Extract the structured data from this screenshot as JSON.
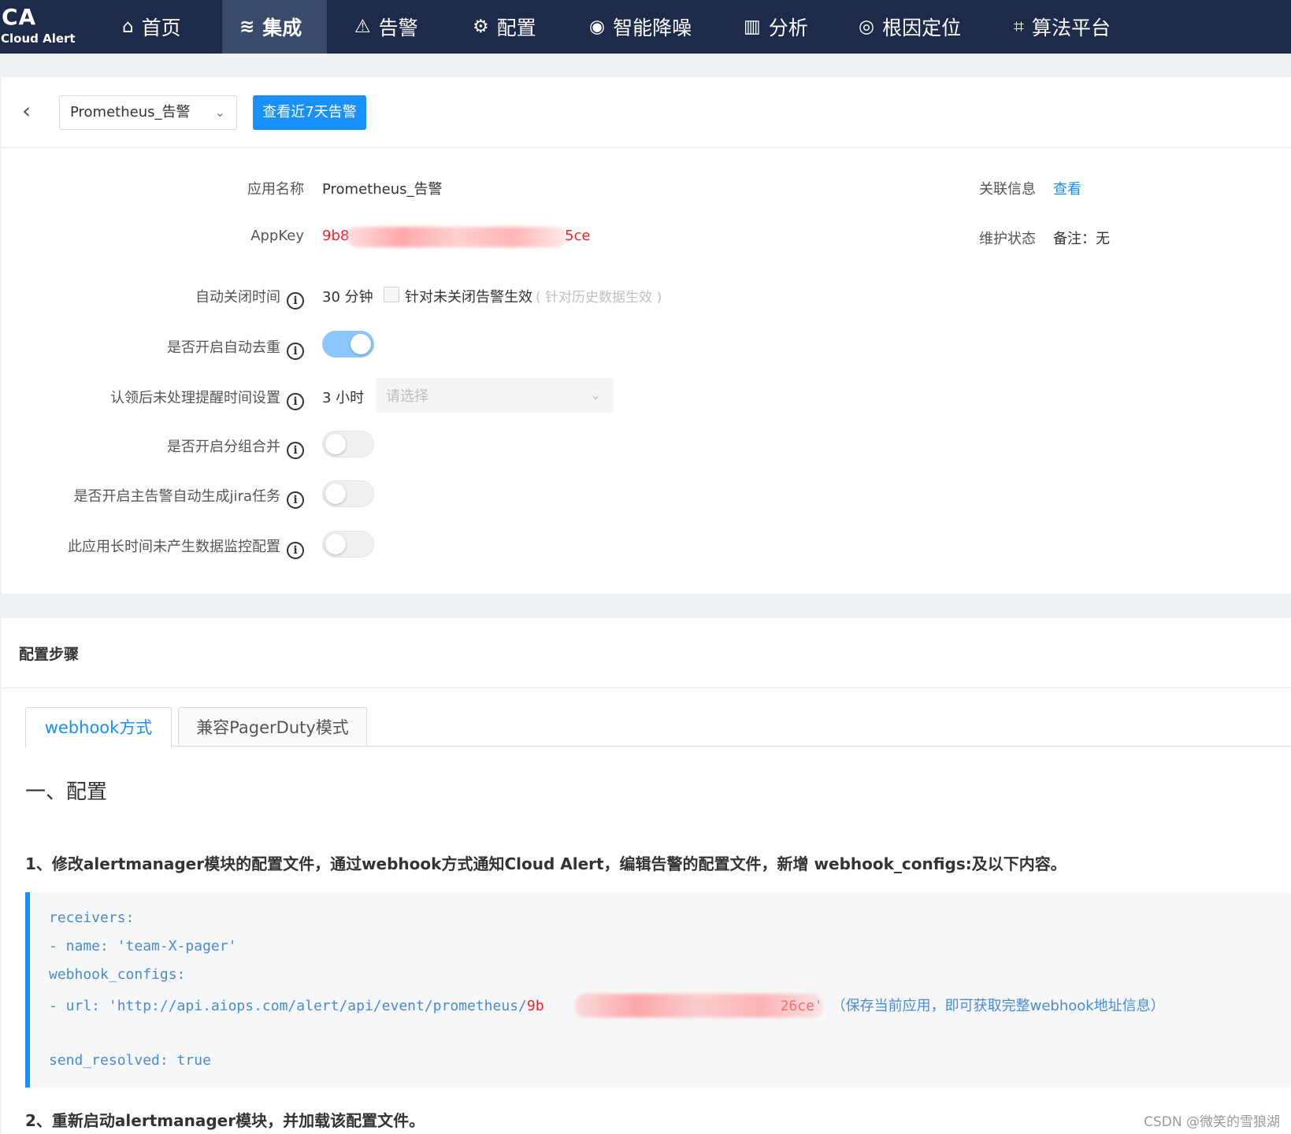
{
  "brand": {
    "logo": "CA",
    "name": "Cloud Alert"
  },
  "nav": [
    {
      "label": "首页",
      "icon": "home-icon",
      "glyph": "⌂"
    },
    {
      "label": "集成",
      "icon": "layers-icon",
      "glyph": "≋",
      "active": true
    },
    {
      "label": "告警",
      "icon": "alarm-icon",
      "glyph": "⚠"
    },
    {
      "label": "配置",
      "icon": "gear-icon",
      "glyph": "⚙"
    },
    {
      "label": "智能降噪",
      "icon": "noise-icon",
      "glyph": "◉"
    },
    {
      "label": "分析",
      "icon": "chart-icon",
      "glyph": "▥"
    },
    {
      "label": "根因定位",
      "icon": "target-icon",
      "glyph": "◎"
    },
    {
      "label": "算法平台",
      "icon": "algorithm-icon",
      "glyph": "⌗"
    }
  ],
  "header": {
    "back_glyph": "‹",
    "app_select_value": "Prometheus_告警",
    "caret_glyph": "⌄",
    "view_alerts_button": "查看近7天告警"
  },
  "details": {
    "app_name_label": "应用名称",
    "app_name_value": "Prometheus_告警",
    "appkey_label": "AppKey",
    "appkey_prefix": "9b8",
    "appkey_suffix": "5ce",
    "related_label": "关联信息",
    "related_link": "查看",
    "maintenance_label": "维护状态",
    "maintenance_value": "备注：无",
    "auto_close_label": "自动关闭时间",
    "auto_close_value": "30 分钟",
    "auto_close_checkbox_label": "针对未关闭告警生效",
    "auto_close_checkbox_hint": "( 针对历史数据生效 )",
    "dedup_label": "是否开启自动去重",
    "dedup_on": true,
    "ack_remind_label": "认领后未处理提醒时间设置",
    "ack_remind_value": "3 小时",
    "ack_remind_placeholder": "请选择",
    "group_merge_label": "是否开启分组合并",
    "group_merge_on": false,
    "jira_label": "是否开启主告警自动生成jira任务",
    "jira_on": false,
    "no_data_label": "此应用长时间未产生数据监控配置",
    "no_data_on": false,
    "info_glyph": "i"
  },
  "steps": {
    "title": "配置步骤",
    "tabs": [
      "webhook方式",
      "兼容PagerDuty模式"
    ],
    "section_heading": "一、配置",
    "step1": "1、修改alertmanager模块的配置文件，通过webhook方式通知Cloud Alert，编辑告警的配置文件，新增 webhook_configs:及以下内容。",
    "code": {
      "line1": "receivers:",
      "line2": "- name: 'team-X-pager'",
      "line3": "webhook_configs:",
      "line4_prefix": "- url: 'http://api.aiops.com/alert/api/event/prometheus/",
      "line4_key_start": "9b",
      "line4_key_end": "26ce",
      "line4_quote": "'",
      "line4_note": "（保存当前应用，即可获取完整webhook地址信息）",
      "line5": "send_resolved: true"
    },
    "step2": "2、重新启动alertmanager模块，并加载该配置文件。"
  },
  "watermark": "CSDN @微笑的雪狼湖",
  "colors": {
    "nav_bg": "#1e2a4a",
    "primary": "#1890ff",
    "danger": "#f5222d"
  }
}
